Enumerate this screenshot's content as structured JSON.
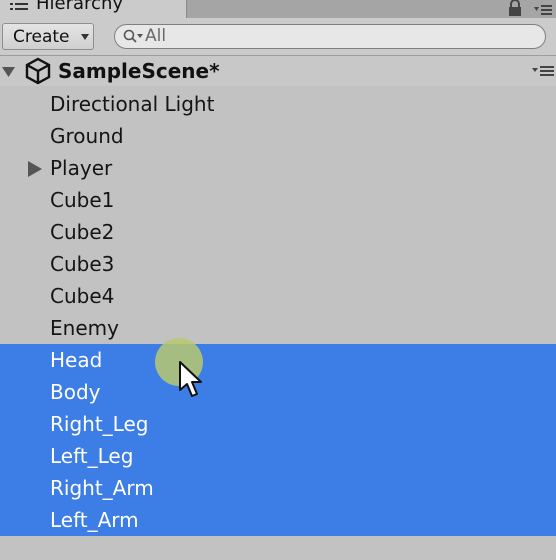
{
  "window": {
    "tab_title": "Hierarchy",
    "tab_icon": "list-icon",
    "lock_icon": "lock-icon",
    "menu_icon": "menu-icon"
  },
  "toolbar": {
    "create_label": "Create",
    "create_caret_icon": "caret-down-icon",
    "search_icon": "search-icon",
    "search_placeholder": "All",
    "search_value": ""
  },
  "scene": {
    "name": "SampleScene*",
    "expanded": true,
    "icon": "unity-icon",
    "menu_icon": "menu-icon"
  },
  "hierarchy": {
    "items": [
      {
        "label": "Directional Light",
        "selected": false,
        "has_children": false
      },
      {
        "label": "Ground",
        "selected": false,
        "has_children": false
      },
      {
        "label": "Player",
        "selected": false,
        "has_children": true
      },
      {
        "label": "Cube1",
        "selected": false,
        "has_children": false
      },
      {
        "label": "Cube2",
        "selected": false,
        "has_children": false
      },
      {
        "label": "Cube3",
        "selected": false,
        "has_children": false
      },
      {
        "label": "Cube4",
        "selected": false,
        "has_children": false
      },
      {
        "label": "Enemy",
        "selected": false,
        "has_children": false
      },
      {
        "label": "Head",
        "selected": true,
        "has_children": false
      },
      {
        "label": "Body",
        "selected": true,
        "has_children": false
      },
      {
        "label": "Right_Leg",
        "selected": true,
        "has_children": false
      },
      {
        "label": "Left_Leg",
        "selected": true,
        "has_children": false
      },
      {
        "label": "Right_Arm",
        "selected": true,
        "has_children": false
      },
      {
        "label": "Left_Arm",
        "selected": true,
        "has_children": false
      }
    ]
  },
  "colors": {
    "selection": "#3d7de6",
    "panel_bg": "#c2c2c2",
    "click_highlight": "#b9c86e"
  }
}
